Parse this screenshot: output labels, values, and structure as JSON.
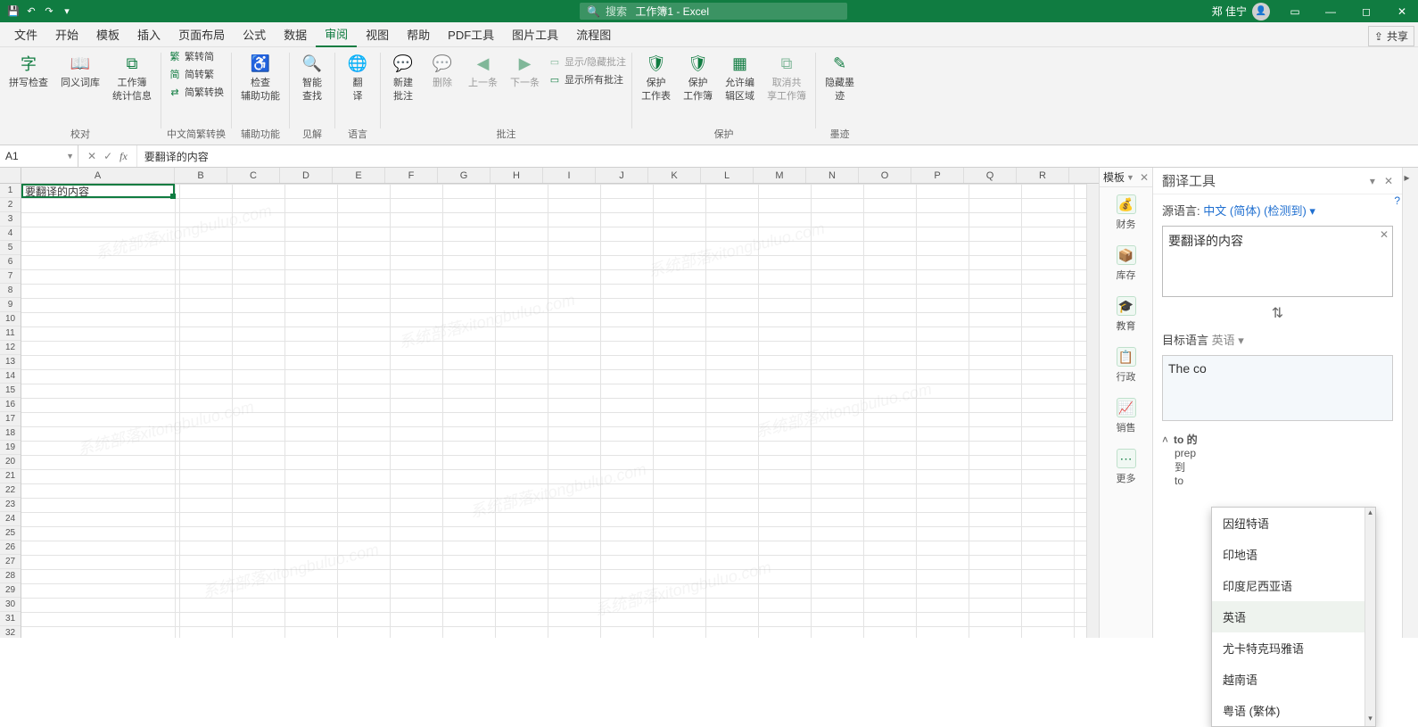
{
  "title": {
    "doc": "工作簿1 - Excel",
    "search_placeholder": "搜索"
  },
  "user": {
    "name": "郑 佳宁"
  },
  "tabs": {
    "items": [
      "文件",
      "开始",
      "模板",
      "插入",
      "页面布局",
      "公式",
      "数据",
      "审阅",
      "视图",
      "帮助",
      "PDF工具",
      "图片工具",
      "流程图"
    ],
    "active": "审阅",
    "share": "共享"
  },
  "ribbon": {
    "g1_label": "校对",
    "g1_btn1_l1": "拼写检查",
    "g1_btn2_l1": "同义词库",
    "g1_btn3_l1": "工作簿",
    "g1_btn3_l2": "统计信息",
    "g2_label": "中文简繁转换",
    "g2_r1": "繁转简",
    "g2_r2": "简转繁",
    "g2_r3": "简繁转换",
    "g3_label": "辅助功能",
    "g3_btn_l1": "检查",
    "g3_btn_l2": "辅助功能",
    "g4_label": "见解",
    "g4_btn_l1": "智能",
    "g4_btn_l2": "查找",
    "g5_label": "语言",
    "g5_btn_l1": "翻",
    "g5_btn_l2": "译",
    "g6_label": "批注",
    "g6_b1_l1": "新建",
    "g6_b1_l2": "批注",
    "g6_b2": "删除",
    "g6_b3": "上一条",
    "g6_b4": "下一条",
    "g6_r1": "显示/隐藏批注",
    "g6_r2": "显示所有批注",
    "g7_label": "保护",
    "g7_b1_l1": "保护",
    "g7_b1_l2": "工作表",
    "g7_b2_l1": "保护",
    "g7_b2_l2": "工作簿",
    "g7_b3_l1": "允许编",
    "g7_b3_l2": "辑区域",
    "g7_b4_l1": "取消共",
    "g7_b4_l2": "享工作簿",
    "g8_label": "墨迹",
    "g8_b1_l1": "隐藏墨",
    "g8_b1_l2": "迹"
  },
  "namebox": "A1",
  "formula_value": "要翻译的内容",
  "active_cell_value": "要翻译的内容",
  "columns": [
    "A",
    "B",
    "C",
    "D",
    "E",
    "F",
    "G",
    "H",
    "I",
    "J",
    "K",
    "L",
    "M",
    "N",
    "O",
    "P",
    "Q",
    "R"
  ],
  "tmpl": {
    "head": "模板",
    "items": [
      {
        "label": "财务"
      },
      {
        "label": "库存"
      },
      {
        "label": "教育"
      },
      {
        "label": "行政"
      },
      {
        "label": "销售"
      },
      {
        "label": "更多"
      }
    ]
  },
  "translate": {
    "title": "翻译工具",
    "src_label": "源语言:",
    "src_lang": "中文 (简体) (检测到)",
    "src_text": "要翻译的内容",
    "tgt_label": "目标语言",
    "tgt_lang": "英语",
    "out_text": "The co",
    "dict_head": "to 的",
    "dict_pos": "prep",
    "dict_l1": "到",
    "dict_l2": "to",
    "options": [
      "因纽特语",
      "印地语",
      "印度尼西亚语",
      "英语",
      "尤卡特克玛雅语",
      "越南语",
      "粤语 (繁体)"
    ],
    "selected_option": "英语"
  }
}
